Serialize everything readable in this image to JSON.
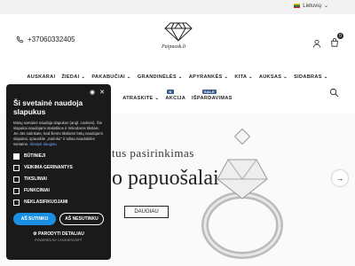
{
  "topbar": {
    "language": "Lietuvių"
  },
  "header": {
    "phone": "+37060332405",
    "logo_text": "Paipuosk.lt",
    "cart_count": "0"
  },
  "nav": {
    "items": [
      "AUSKARAI",
      "ŽIEDAI",
      "PAKABUČIAI",
      "GRANDINĖLĖS",
      "APYRANKĖS",
      "KITA",
      "AUKSAS",
      "SIDABRAS"
    ],
    "row2": [
      "ATRASKITE",
      "AKCIJA",
      "IŠPARDAVIMAS"
    ],
    "badges": {
      "new": "N",
      "sale": "SALE"
    }
  },
  "hero": {
    "subtitle": "tus pasirinkimas",
    "title": "o papuošalai",
    "button": "DAUGIAU"
  },
  "cookie": {
    "title": "Ši svetainė naudoja slapukus",
    "text": "Mūsų svetainė naudoja slapukus (angl. cookies). Šie slapukai naudojami statistikos ir rinkodaros tikslais. Jei Jūs sutinkate, kad šiems tikslams būtų naudojami slapukai, spauskite „Sutinku\" ir toliau naudokitės svetaine.",
    "link": "Skaityti daugiau",
    "options": [
      "BŪTINIEJI",
      "VEIKIMA GERINANTYS",
      "TIKSLINIAI",
      "FUNKCINIAI",
      "NEKLASIFIKUOJAMI"
    ],
    "accept": "AŠ SUTINKU",
    "decline": "AŠ NESUTINKU",
    "details": "PARODYTI DETALIAU",
    "powered": "POWERED BY COOKIESCRIPT"
  }
}
